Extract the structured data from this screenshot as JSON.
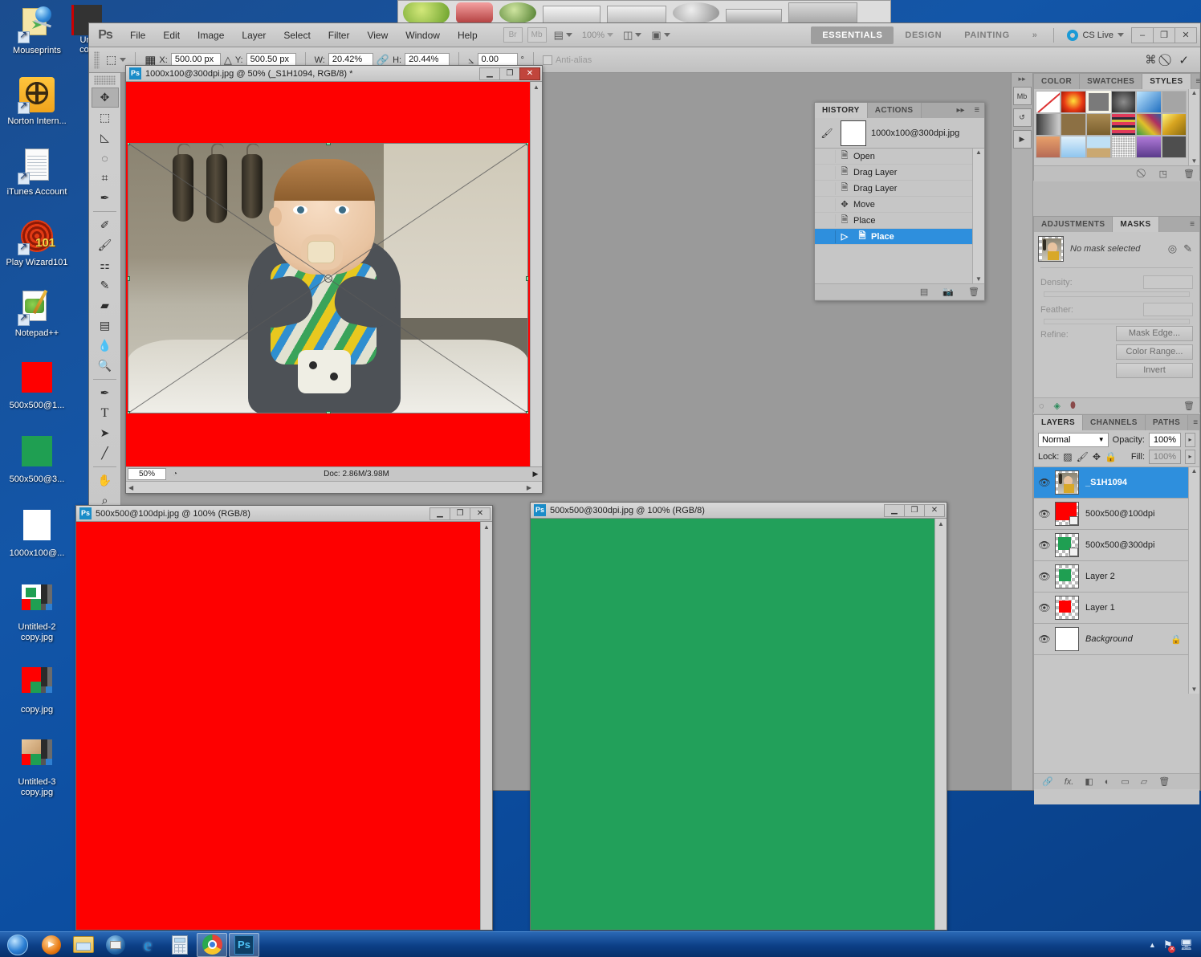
{
  "desktop": {
    "icons": [
      {
        "label": "Mouseprints",
        "type": "shortcut-note"
      },
      {
        "label": "Norton Intern...",
        "type": "norton-globe"
      },
      {
        "label": "iTunes Account",
        "type": "document"
      },
      {
        "label": "Play Wizard101",
        "type": "wizard-spiral"
      },
      {
        "label": "Notepad++",
        "type": "notepad-plus"
      },
      {
        "label": "500x500@1...",
        "type": "image-red",
        "color": "#ff0000"
      },
      {
        "label": "500x500@3...",
        "type": "image-green",
        "color": "#1f9f52"
      },
      {
        "label": "1000x100@...",
        "type": "image-white",
        "color": "#ffffff"
      },
      {
        "label": "Untitled-2 copy.jpg",
        "type": "screenshot-thumb"
      },
      {
        "label": "copy.jpg",
        "type": "screenshot-thumb"
      },
      {
        "label": "Untitled-3 copy.jpg",
        "type": "screenshot-thumb"
      }
    ],
    "partial_icons": [
      {
        "label": "Unt",
        "label2": "cop"
      }
    ]
  },
  "photoshop": {
    "logo": "Ps",
    "menus": [
      "File",
      "Edit",
      "Image",
      "Layer",
      "Select",
      "Filter",
      "View",
      "Window",
      "Help"
    ],
    "menubar_buttons": [
      {
        "name": "bridge",
        "label": "Br"
      },
      {
        "name": "mini-bridge",
        "label": "Mb"
      }
    ],
    "view_extras_label": "",
    "zoom_level": "100%",
    "workspaces": [
      {
        "label": "ESSENTIALS",
        "active": true
      },
      {
        "label": "DESIGN",
        "active": false
      },
      {
        "label": "PAINTING",
        "active": false
      }
    ],
    "workspace_overflow": "»",
    "cs_live": "CS Live",
    "window_buttons": [
      "–",
      "❐",
      "✕"
    ],
    "options_bar": {
      "tool_icon": "move-tool-icon",
      "ref_point_icon": "reference-point-icon",
      "x_label": "X:",
      "x_value": "500.00 px",
      "delta_icon": "△",
      "y_label": "Y:",
      "y_value": "500.50 px",
      "w_label": "W:",
      "w_value": "20.42%",
      "link_icon": "link-icon",
      "h_label": "H:",
      "h_value": "20.44%",
      "angle_icon": "⦣",
      "angle_value": "0.00",
      "degree_symbol": "°",
      "antialias_label": "Anti-alias",
      "warp_icon": "warp-icon",
      "cancel_icon": "⃠",
      "commit_icon": "✓"
    },
    "tools": [
      {
        "name": "move-tool",
        "glyph": "➤"
      },
      {
        "name": "rectangular-marquee-tool",
        "glyph": "⬚"
      },
      {
        "name": "lasso-tool",
        "glyph": "✐"
      },
      {
        "name": "quick-selection-tool",
        "glyph": "◌"
      },
      {
        "name": "crop-tool",
        "glyph": "⌗"
      },
      {
        "name": "eyedropper-tool",
        "glyph": "✒"
      },
      {
        "name": "spot-healing-brush-tool",
        "glyph": "✎"
      },
      {
        "name": "brush-tool",
        "glyph": "✑"
      },
      {
        "name": "clone-stamp-tool",
        "glyph": "⚑"
      },
      {
        "name": "history-brush-tool",
        "glyph": "✄"
      },
      {
        "name": "eraser-tool",
        "glyph": "▰"
      },
      {
        "name": "gradient-tool",
        "glyph": "▤"
      },
      {
        "name": "blur-tool",
        "glyph": "●"
      },
      {
        "name": "dodge-tool",
        "glyph": "⚲"
      },
      {
        "name": "pen-tool",
        "glyph": "✒"
      },
      {
        "name": "type-tool",
        "glyph": "T"
      },
      {
        "name": "path-selection-tool",
        "glyph": "➤"
      },
      {
        "name": "line-tool",
        "glyph": "╱"
      },
      {
        "name": "hand-tool",
        "glyph": "✋"
      },
      {
        "name": "zoom-tool",
        "glyph": "⌕"
      }
    ],
    "colors": {
      "foreground": "#ffffff",
      "background": "#000000"
    }
  },
  "documents": [
    {
      "name": "doc-1000x100",
      "title": "1000x100@300dpi.jpg @ 50% (_S1H1094, RGB/8) *",
      "zoom": "50%",
      "status": "Doc: 2.86M/3.98M",
      "canvas_color": "#fe0000",
      "has_transform": true
    },
    {
      "name": "doc-500x500-100dpi",
      "title": "500x500@100dpi.jpg @ 100% (RGB/8)",
      "canvas_color": "#fe0000"
    },
    {
      "name": "doc-500x500-300dpi",
      "title": "500x500@300dpi.jpg @ 100% (RGB/8)",
      "canvas_color": "#22a05a"
    }
  ],
  "history_panel": {
    "tabs": [
      {
        "label": "HISTORY",
        "active": true
      },
      {
        "label": "ACTIONS",
        "active": false
      }
    ],
    "collapse_icon": "▸▸",
    "menu_icon": "≡",
    "snapshot": "1000x100@300dpi.jpg",
    "items": [
      {
        "label": "Open",
        "icon": "document-icon",
        "selected": false
      },
      {
        "label": "Drag Layer",
        "icon": "document-icon",
        "selected": false
      },
      {
        "label": "Drag Layer",
        "icon": "document-icon",
        "selected": false
      },
      {
        "label": "Move",
        "icon": "move-icon",
        "selected": false
      },
      {
        "label": "Place",
        "icon": "document-icon",
        "selected": false
      },
      {
        "label": "Place",
        "icon": "document-icon",
        "selected": true
      }
    ],
    "footer_icons": [
      "new-document-icon",
      "new-snapshot-icon",
      "delete-icon"
    ]
  },
  "dock": {
    "icon_buttons": [
      {
        "name": "mini-bridge-icon",
        "label": "Mb"
      },
      {
        "name": "history-icon",
        "label": "↺"
      },
      {
        "name": "actions-icon",
        "label": "▶"
      }
    ],
    "styles_panel": {
      "tabs": [
        {
          "label": "COLOR",
          "active": false
        },
        {
          "label": "SWATCHES",
          "active": false
        },
        {
          "label": "STYLES",
          "active": true
        }
      ],
      "menu_icon": "≡",
      "swatches": [
        "none",
        "#e8321a",
        "#6e6e6e",
        "#4a4a4a",
        "#2f8fd8",
        "#9a9a9a",
        "#5c5c5c",
        "#8a7046",
        "#9a7d4f",
        "#d0344f",
        "#2e7a46",
        "#d9c32a",
        "#d8906a",
        "#9fd0ef",
        "#c9b18a",
        "#8f8f8f",
        "#8a4fc0",
        "#4d4d4d"
      ],
      "footer_icons": [
        "clear-style-icon",
        "new-style-icon",
        "delete-style-icon"
      ]
    },
    "masks_panel": {
      "tabs": [
        {
          "label": "ADJUSTMENTS",
          "active": false
        },
        {
          "label": "MASKS",
          "active": true
        }
      ],
      "menu_icon": "≡",
      "status": "No mask selected",
      "header_icons": [
        "add-pixel-mask-icon",
        "add-vector-mask-icon"
      ],
      "density_label": "Density:",
      "density_value": "",
      "feather_label": "Feather:",
      "feather_value": "",
      "refine_label": "Refine:",
      "buttons": [
        "Mask Edge...",
        "Color Range...",
        "Invert"
      ],
      "footer_icons": [
        "selection-from-mask-icon",
        "apply-mask-icon",
        "disable-mask-icon",
        "delete-mask-icon"
      ]
    },
    "layers_panel": {
      "tabs": [
        {
          "label": "LAYERS",
          "active": true
        },
        {
          "label": "CHANNELS",
          "active": false
        },
        {
          "label": "PATHS",
          "active": false
        }
      ],
      "menu_icon": "≡",
      "blend_mode": "Normal",
      "opacity_label": "Opacity:",
      "opacity_value": "100%",
      "lock_label": "Lock:",
      "lock_icons": [
        "lock-transparent-icon",
        "lock-image-icon",
        "lock-position-icon",
        "lock-all-icon"
      ],
      "fill_label": "Fill:",
      "fill_value": "100%",
      "layers": [
        {
          "name": "_S1H1094",
          "selected": true,
          "visible": true,
          "thumb": "photo",
          "locked": false,
          "italic": false
        },
        {
          "name": "500x500@100dpi",
          "selected": false,
          "visible": true,
          "thumb": "#ff0000",
          "smart": true,
          "locked": false,
          "italic": false
        },
        {
          "name": "500x500@300dpi",
          "selected": false,
          "visible": true,
          "thumb": "#1f9f52",
          "smart": true,
          "locked": false,
          "italic": false
        },
        {
          "name": "Layer 2",
          "selected": false,
          "visible": true,
          "thumb": "#1f9f52",
          "locked": false,
          "italic": false
        },
        {
          "name": "Layer 1",
          "selected": false,
          "visible": true,
          "thumb": "#ff0000",
          "locked": false,
          "italic": false
        },
        {
          "name": "Background",
          "selected": false,
          "visible": true,
          "thumb": "#ffffff",
          "locked": true,
          "italic": true
        }
      ],
      "footer_icons": [
        "link-layers-icon",
        "layer-style-icon",
        "add-mask-icon",
        "adjustment-layer-icon",
        "new-group-icon",
        "new-layer-icon",
        "delete-layer-icon"
      ]
    }
  },
  "taskbar": {
    "start_label": "Start",
    "items": [
      {
        "name": "windows-media-player-icon",
        "active": false
      },
      {
        "name": "windows-explorer-icon",
        "active": false
      },
      {
        "name": "thunderbird-icon",
        "active": false
      },
      {
        "name": "internet-explorer-icon",
        "active": false
      },
      {
        "name": "calculator-icon",
        "active": false
      },
      {
        "name": "google-chrome-icon",
        "active": true
      },
      {
        "name": "photoshop-icon",
        "active": true
      }
    ],
    "tray_icons": [
      "show-hidden-icons",
      "network-warning-icon",
      "display-icon"
    ]
  }
}
